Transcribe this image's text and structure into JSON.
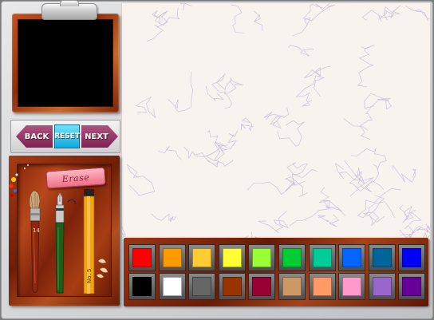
{
  "nav": {
    "back_label": "BACK",
    "reset_label": "RESET",
    "next_label": "NEXT"
  },
  "tools": {
    "eraser_label": "Erase",
    "brush_number": "14",
    "pencil_label": "No. 5",
    "items": [
      "eraser-icon",
      "paintbrush-icon",
      "fountain-pen-icon",
      "pencil-icon"
    ]
  },
  "palette": {
    "row1": [
      "#ff0000",
      "#ff9900",
      "#ffcc33",
      "#ffff33",
      "#99ff33",
      "#00cc33",
      "#00cc99",
      "#0066ff",
      "#006699",
      "#0000ff"
    ],
    "row2": [
      "#000000",
      "#ffffff",
      "#666666",
      "#993300",
      "#990033",
      "#cc9966",
      "#ff9966",
      "#ff99cc",
      "#9966cc",
      "#660099"
    ]
  },
  "colors": {
    "preview_screen": "#000000",
    "canvas": "#f9f3ef",
    "reset_button": "#33ccff",
    "nav_arrow": "#99336a",
    "wood": "#8b2e0d"
  }
}
